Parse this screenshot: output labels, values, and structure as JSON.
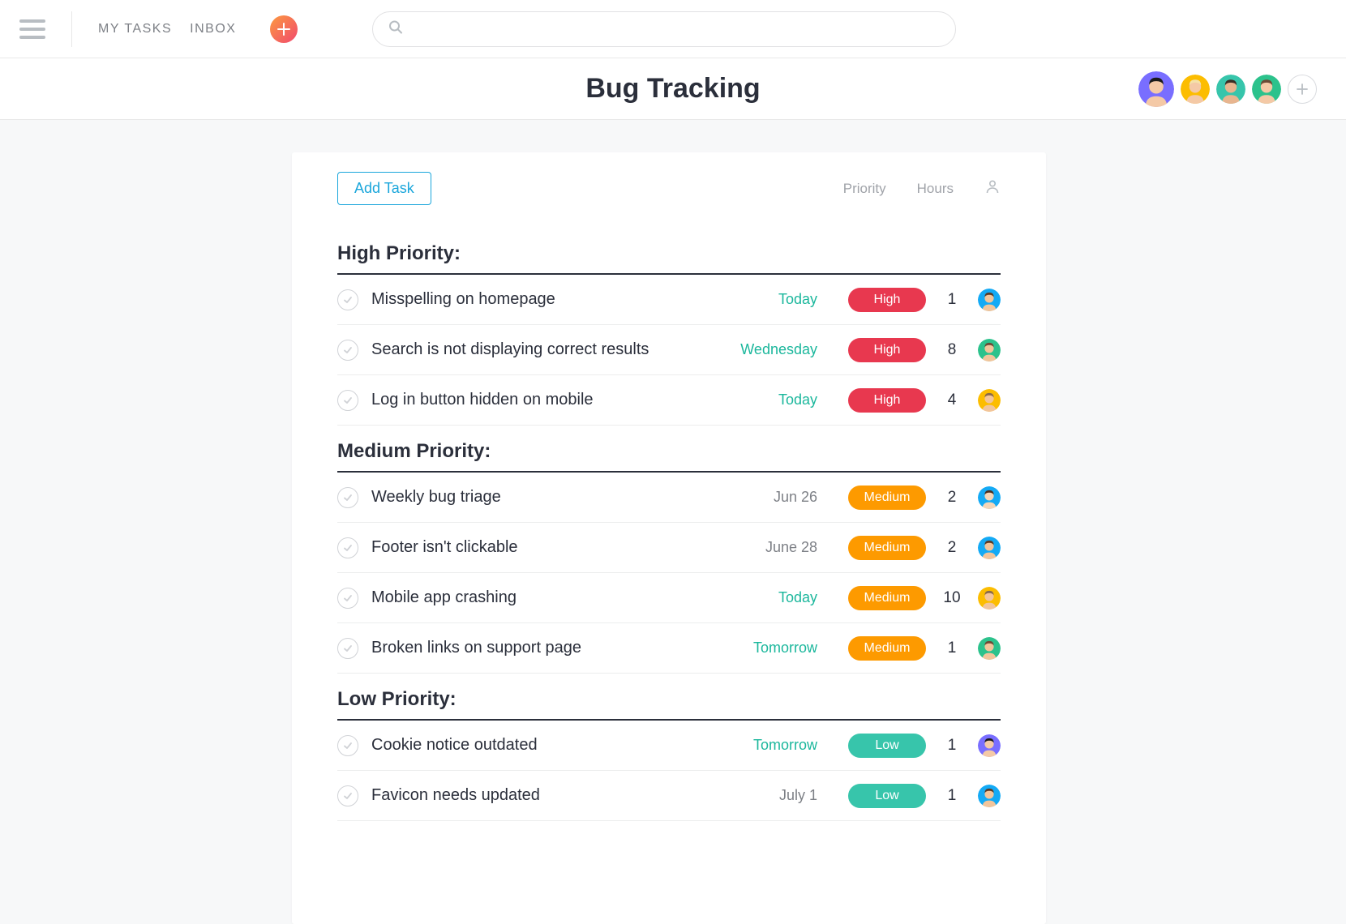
{
  "nav": {
    "my_tasks": "MY TASKS",
    "inbox": "INBOX"
  },
  "search": {
    "placeholder": ""
  },
  "page_title": "Bug Tracking",
  "members": [
    {
      "bg": "#796eff",
      "face": "#f4c9a6",
      "hair": "#1a1a1a"
    },
    {
      "bg": "#fcbd01",
      "face": "#f4c9a6",
      "hair": "#f4e2a9"
    },
    {
      "bg": "#37c5ab",
      "face": "#e8b58f",
      "hair": "#3a2e25"
    },
    {
      "bg": "#2cc28c",
      "face": "#f4c9a6",
      "hair": "#6b4a35"
    }
  ],
  "card": {
    "add_task_label": "Add Task",
    "col_priority": "Priority",
    "col_hours": "Hours"
  },
  "priority_labels": {
    "high": "High",
    "medium": "Medium",
    "low": "Low"
  },
  "sections": [
    {
      "title": "High Priority:",
      "tasks": [
        {
          "name": "Misspelling on homepage",
          "date": "Today",
          "date_color": "green",
          "priority": "high",
          "hours": "1",
          "avatar": {
            "bg": "#14aaf5",
            "face": "#f2c59b",
            "hair": "#5a3b27"
          }
        },
        {
          "name": "Search is not displaying correct results",
          "date": "Wednesday",
          "date_color": "green",
          "priority": "high",
          "hours": "8",
          "avatar": {
            "bg": "#2cc28c",
            "face": "#f2c59b",
            "hair": "#6b4a35"
          }
        },
        {
          "name": "Log in button hidden on mobile",
          "date": "Today",
          "date_color": "green",
          "priority": "high",
          "hours": "4",
          "avatar": {
            "bg": "#fcbd01",
            "face": "#f2c59b",
            "hair": "#8a6a4a"
          }
        }
      ]
    },
    {
      "title": "Medium Priority:",
      "tasks": [
        {
          "name": "Weekly bug triage",
          "date": "Jun 26",
          "date_color": "gray",
          "priority": "medium",
          "hours": "2",
          "avatar": {
            "bg": "#14aaf5",
            "face": "#f4d6b8",
            "hair": "#4a2f1f"
          }
        },
        {
          "name": "Footer isn't clickable",
          "date": "June 28",
          "date_color": "gray",
          "priority": "medium",
          "hours": "2",
          "avatar": {
            "bg": "#14aaf5",
            "face": "#f2c59b",
            "hair": "#5a3b27"
          }
        },
        {
          "name": "Mobile app crashing",
          "date": "Today",
          "date_color": "green",
          "priority": "medium",
          "hours": "10",
          "avatar": {
            "bg": "#fcbd01",
            "face": "#f2c59b",
            "hair": "#8a6a4a"
          }
        },
        {
          "name": "Broken links on support page",
          "date": "Tomorrow",
          "date_color": "green",
          "priority": "medium",
          "hours": "1",
          "avatar": {
            "bg": "#2cc28c",
            "face": "#f2c59b",
            "hair": "#6b4a35"
          }
        }
      ]
    },
    {
      "title": "Low Priority:",
      "tasks": [
        {
          "name": "Cookie notice outdated",
          "date": "Tomorrow",
          "date_color": "green",
          "priority": "low",
          "hours": "1",
          "avatar": {
            "bg": "#796eff",
            "face": "#f4c9a6",
            "hair": "#1a1a1a"
          }
        },
        {
          "name": "Favicon needs updated",
          "date": "July 1",
          "date_color": "gray",
          "priority": "low",
          "hours": "1",
          "avatar": {
            "bg": "#14aaf5",
            "face": "#f2c59b",
            "hair": "#5a3b27"
          }
        }
      ]
    }
  ]
}
